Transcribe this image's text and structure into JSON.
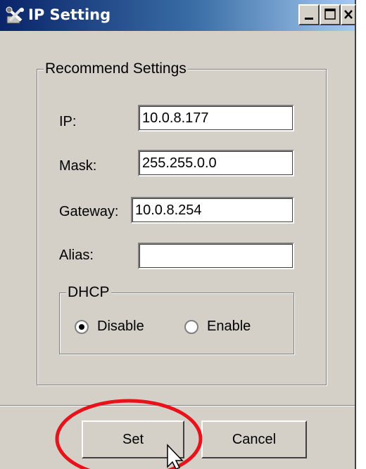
{
  "window": {
    "title": "IP Setting",
    "minimize_label": "minimize",
    "maximize_label": "maximize",
    "close_label": "close"
  },
  "recommend_settings": {
    "legend": "Recommend Settings",
    "fields": [
      {
        "label": "IP:",
        "value": "10.0.8.177"
      },
      {
        "label": "Mask:",
        "value": "255.255.0.0"
      },
      {
        "label": "Gateway:",
        "value": "10.0.8.254"
      },
      {
        "label": "Alias:",
        "value": ""
      }
    ],
    "dhcp": {
      "legend": "DHCP",
      "options": [
        {
          "label": "Disable",
          "selected": true
        },
        {
          "label": "Enable",
          "selected": false
        }
      ]
    }
  },
  "buttons": {
    "set": "Set",
    "cancel": "Cancel"
  },
  "colors": {
    "highlight_circle": "#e8121b",
    "titlebar_start": "#0a246a",
    "titlebar_end": "#a6caf0"
  }
}
